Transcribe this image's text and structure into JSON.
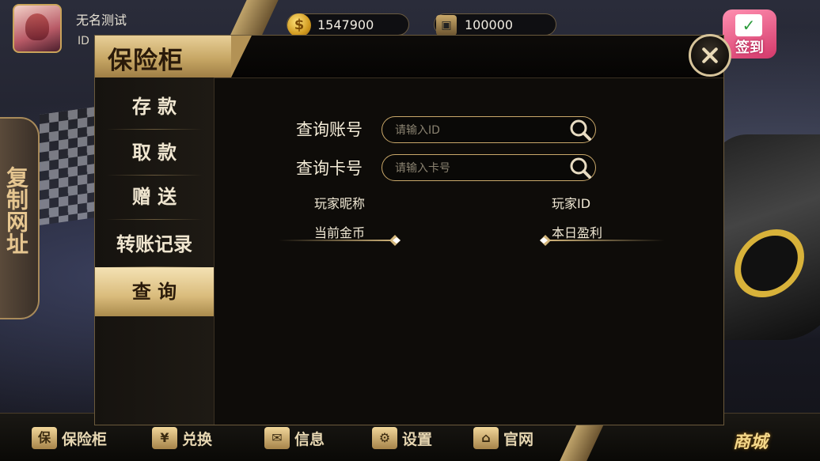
{
  "user": {
    "nickname": "无名测试",
    "id_label": "ID"
  },
  "currency": {
    "gold": "1547900",
    "bank": "100000",
    "gold_icon": "$"
  },
  "checkin": {
    "label": "签到"
  },
  "copy_url": {
    "label": "复制网址"
  },
  "safe": {
    "title": "保险柜",
    "tabs": [
      {
        "label": "存 款"
      },
      {
        "label": "取 款"
      },
      {
        "label": "赠 送"
      },
      {
        "label": "转账记录"
      },
      {
        "label": "查 询"
      }
    ],
    "active_tab": 4,
    "query": {
      "account_label": "查询账号",
      "account_placeholder": "请输入ID",
      "card_label": "查询卡号",
      "card_placeholder": "请输入卡号",
      "player_nickname_label": "玩家昵称",
      "player_id_label": "玩家ID",
      "current_gold_label": "当前金币",
      "today_profit_label": "本日盈利"
    }
  },
  "bottom_nav": [
    {
      "label": "保险柜",
      "icon": "safe-icon",
      "glyph": "保"
    },
    {
      "label": "兑换",
      "icon": "exchange-icon",
      "glyph": "¥"
    },
    {
      "label": "信息",
      "icon": "mail-icon",
      "glyph": "✉"
    },
    {
      "label": "设置",
      "icon": "gear-icon",
      "glyph": "⚙"
    },
    {
      "label": "官网",
      "icon": "website-icon",
      "glyph": "⌂"
    }
  ],
  "shop": {
    "label": "商城"
  },
  "colors": {
    "gold_accent": "#c9a86a",
    "panel_bg": "#0e0c09",
    "active_tab": "#d9bb7b"
  }
}
